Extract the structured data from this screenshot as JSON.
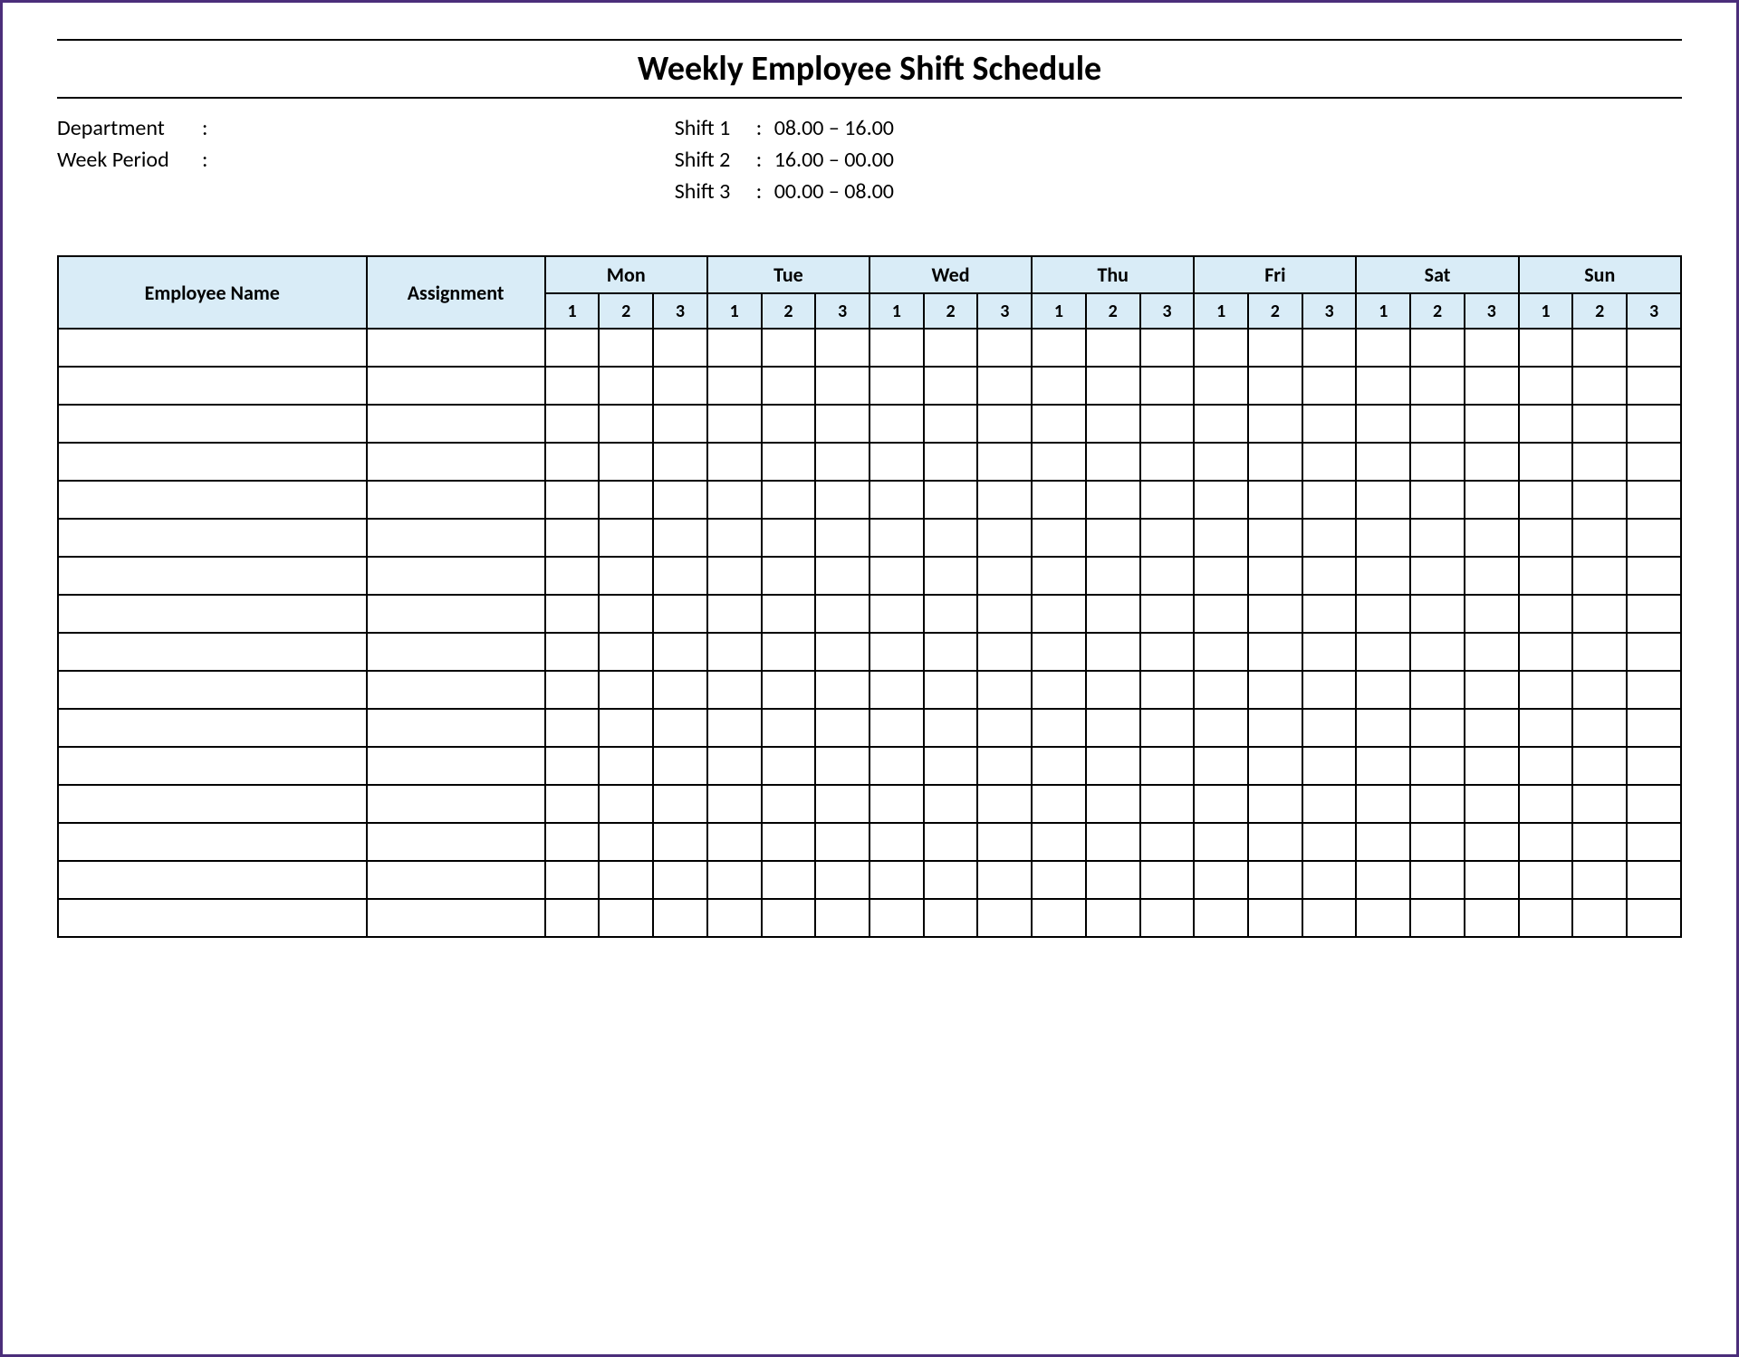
{
  "title": "Weekly Employee Shift Schedule",
  "meta": {
    "department_label": "Department",
    "week_period_label": "Week Period",
    "colon": ":"
  },
  "shifts": [
    {
      "label": "Shift 1",
      "time": "08.00 – 16.00"
    },
    {
      "label": "Shift 2",
      "time": "16.00 – 00.00"
    },
    {
      "label": "Shift 3",
      "time": "00.00 – 08.00"
    }
  ],
  "table": {
    "employee_name_header": "Employee Name",
    "assignment_header": "Assignment",
    "days": [
      "Mon",
      "Tue",
      "Wed",
      "Thu",
      "Fri",
      "Sat",
      "Sun"
    ],
    "shift_numbers": [
      "1",
      "2",
      "3"
    ],
    "row_count": 16
  }
}
